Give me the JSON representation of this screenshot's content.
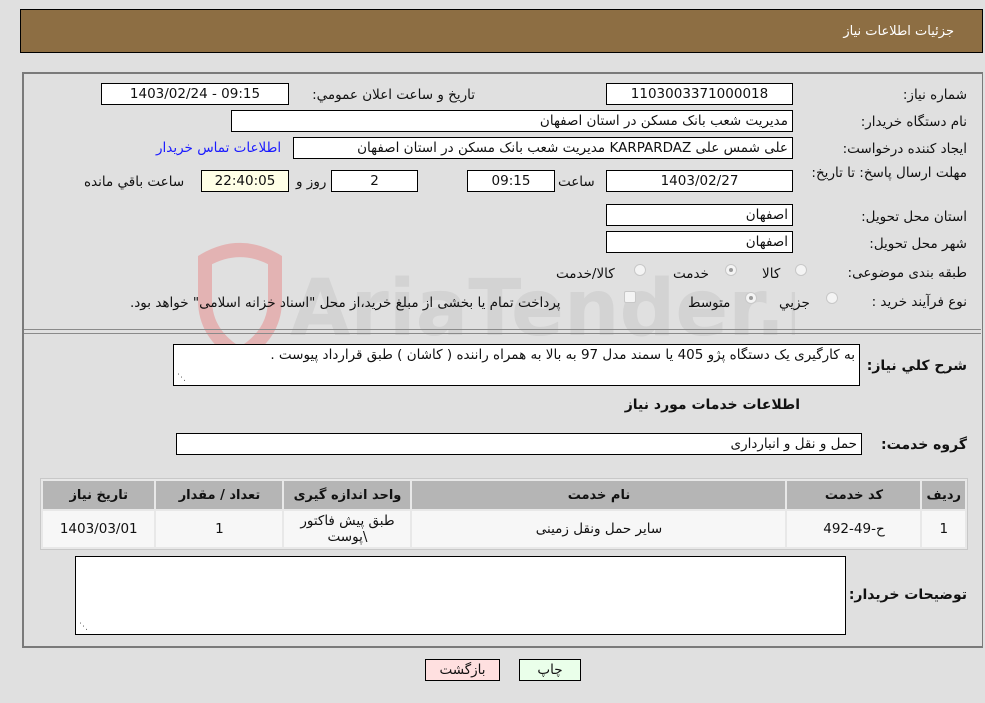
{
  "header": {
    "title": "جزئیات اطلاعات نیاز"
  },
  "form": {
    "need_number": {
      "label": "شماره نیاز:",
      "value": "1103003371000018"
    },
    "announce_datetime": {
      "label": "تاریخ و ساعت اعلان عمومي:",
      "value": "1403/02/24 - 09:15"
    },
    "buyer_org": {
      "label": "نام دستگاه خريدار:",
      "value": "مديريت شعب بانک مسکن در استان اصفهان"
    },
    "requester": {
      "label": "ایجاد کننده درخواست:",
      "value": "علی شمس علی KARPARDAZ مدیریت شعب بانک مسکن در استان اصفهان"
    },
    "buyer_contact_link": "اطلاعات تماس خريدار",
    "deadline": {
      "label": "مهلت ارسال پاسخ: تا تاریخ:",
      "date": "1403/02/27",
      "time_label": "ساعت",
      "time": "09:15",
      "days": "2",
      "days_label": "روز و",
      "remaining": "22:40:05",
      "remaining_label": "ساعت باقي مانده"
    },
    "delivery_province": {
      "label": "استان محل تحویل:",
      "value": "اصفهان"
    },
    "delivery_city": {
      "label": "شهر محل تحویل:",
      "value": "اصفهان"
    },
    "category": {
      "label": "طبقه بندی موضوعی:",
      "options": [
        "کالا",
        "خدمت",
        "کالا/خدمت"
      ],
      "selected": "خدمت"
    },
    "purchase_process": {
      "label": "نوع فرآيند خريد :",
      "options": [
        "جزيي",
        "متوسط"
      ],
      "selected": "متوسط",
      "treasury_note": "پرداخت تمام يا بخشی از مبلغ خريد،از محل \"اسناد خزانه اسلامی\" خواهد بود."
    },
    "description": {
      "label": "شرح کلي نياز:",
      "value": "به کارگیری یک دستگاه پژو 405 یا سمند مدل 97 به بالا به همراه راننده ( کاشان ) طبق قرارداد پیوست ."
    }
  },
  "services": {
    "section_title": "اطلاعات خدمات مورد نياز",
    "group_label": "گروه خدمت:",
    "group_value": "حمل و نقل و انبارداری",
    "columns": [
      "رديف",
      "کد خدمت",
      "نام خدمت",
      "واحد اندازه گیری",
      "تعداد / مقدار",
      "تاریخ نیاز"
    ],
    "rows": [
      {
        "row": "1",
        "code": "ح-49-492",
        "name": "سایر حمل ونقل زمینی",
        "unit": "طبق پیش فاکتور \\پوست",
        "qty": "1",
        "date": "1403/03/01"
      }
    ]
  },
  "buyer_notes": {
    "label": "توضیحات خریدار:",
    "value": ""
  },
  "buttons": {
    "print": "چاپ",
    "back": "بازگشت"
  },
  "watermark": {
    "text": "AriaTender.neT"
  },
  "colors": {
    "header_bg": "#8d6e43",
    "link": "#1a1aff",
    "print_bg": "#eaffea",
    "back_bg": "#ffe0e0"
  }
}
